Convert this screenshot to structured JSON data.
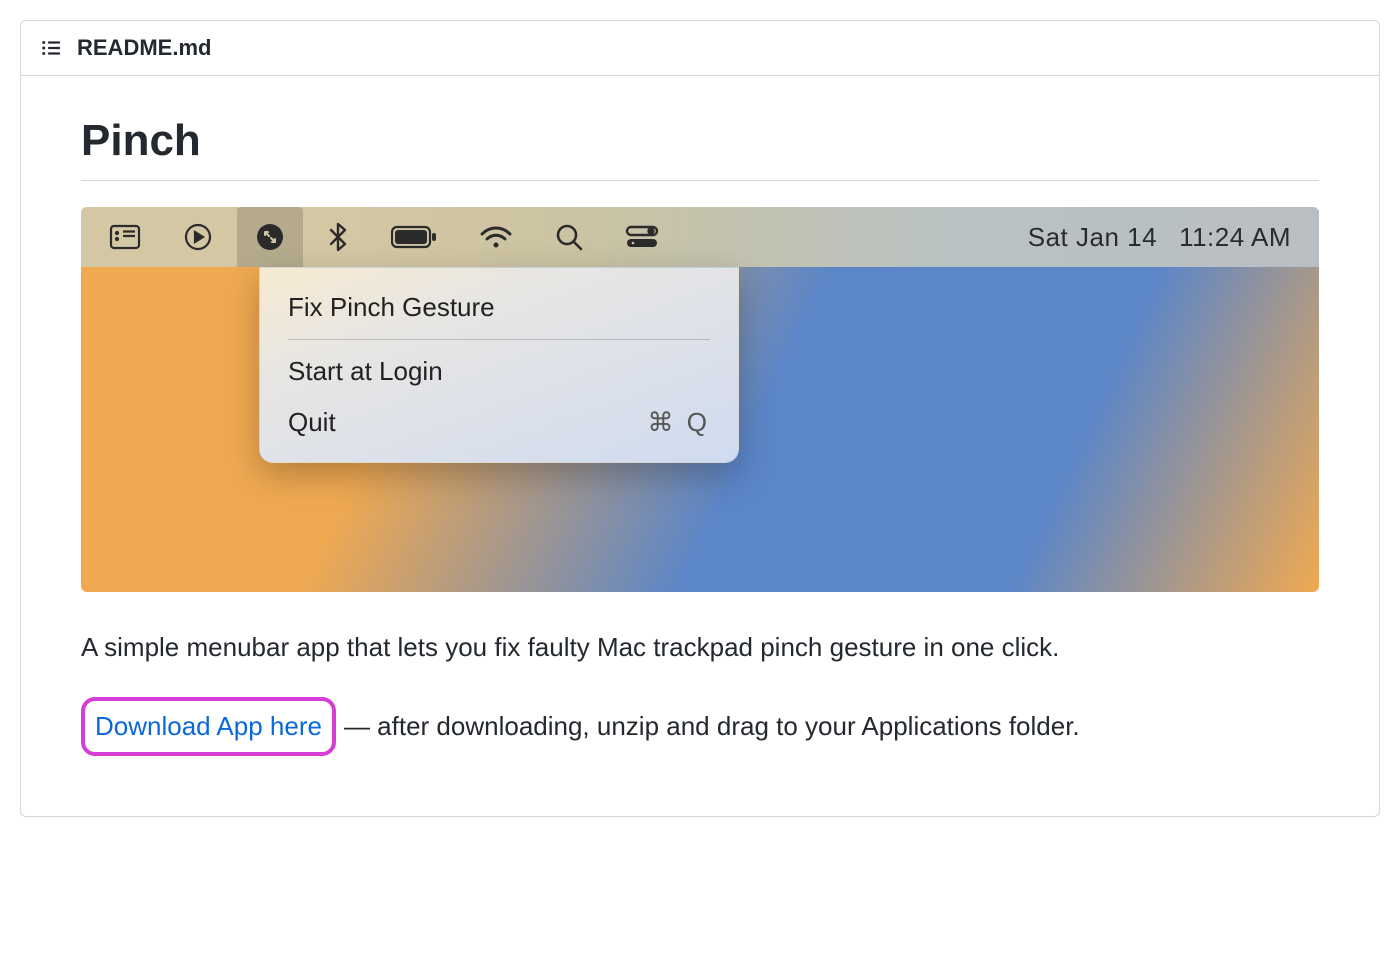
{
  "header": {
    "filename": "README.md"
  },
  "content": {
    "title": "Pinch",
    "description": "A simple menubar app that lets you fix faulty Mac trackpad pinch gesture in one click.",
    "download_link_label": "Download App here",
    "download_suffix": "— after downloading, unzip and drag to your Applications folder."
  },
  "screenshot": {
    "menubar": {
      "date": "Sat Jan 14",
      "time": "11:24 AM"
    },
    "dropdown": {
      "item1": "Fix Pinch Gesture",
      "item2": "Start at Login",
      "item3": "Quit",
      "item3_shortcut": "⌘ Q"
    }
  }
}
